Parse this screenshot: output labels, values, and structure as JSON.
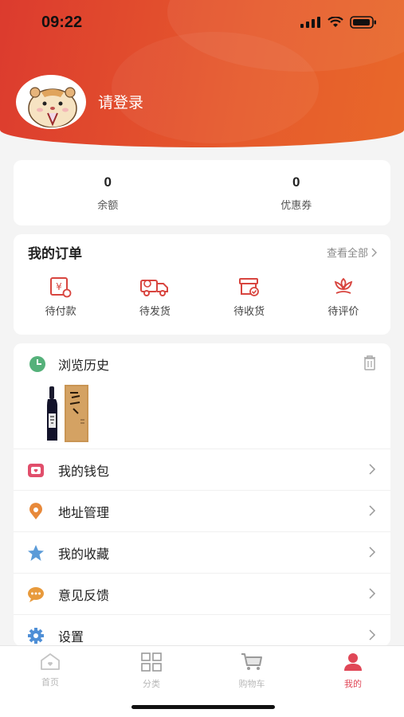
{
  "status_bar": {
    "time": "09:22"
  },
  "profile": {
    "login_label": "请登录"
  },
  "stats": [
    {
      "value": "0",
      "label": "余额"
    },
    {
      "value": "0",
      "label": "优惠券"
    }
  ],
  "orders": {
    "title": "我的订单",
    "view_all": "查看全部",
    "items": [
      {
        "label": "待付款",
        "icon": "pending-payment-icon"
      },
      {
        "label": "待发货",
        "icon": "delivery-truck-icon"
      },
      {
        "label": "待收货",
        "icon": "receive-box-icon"
      },
      {
        "label": "待评价",
        "icon": "review-flower-icon"
      }
    ]
  },
  "history": {
    "title": "浏览历史"
  },
  "menu": [
    {
      "label": "我的钱包",
      "icon": "wallet-icon"
    },
    {
      "label": "地址管理",
      "icon": "location-icon"
    },
    {
      "label": "我的收藏",
      "icon": "star-icon"
    },
    {
      "label": "意见反馈",
      "icon": "chat-icon"
    },
    {
      "label": "设置",
      "icon": "gear-icon"
    }
  ],
  "tabbar": [
    {
      "label": "首页",
      "icon": "home-icon"
    },
    {
      "label": "分类",
      "icon": "grid-icon"
    },
    {
      "label": "购物车",
      "icon": "cart-icon"
    },
    {
      "label": "我的",
      "icon": "user-icon"
    }
  ],
  "colors": {
    "header_start": "#dc3b2e",
    "header_end": "#e8682a",
    "accent": "#e04757",
    "icon_red": "#d8453f"
  }
}
